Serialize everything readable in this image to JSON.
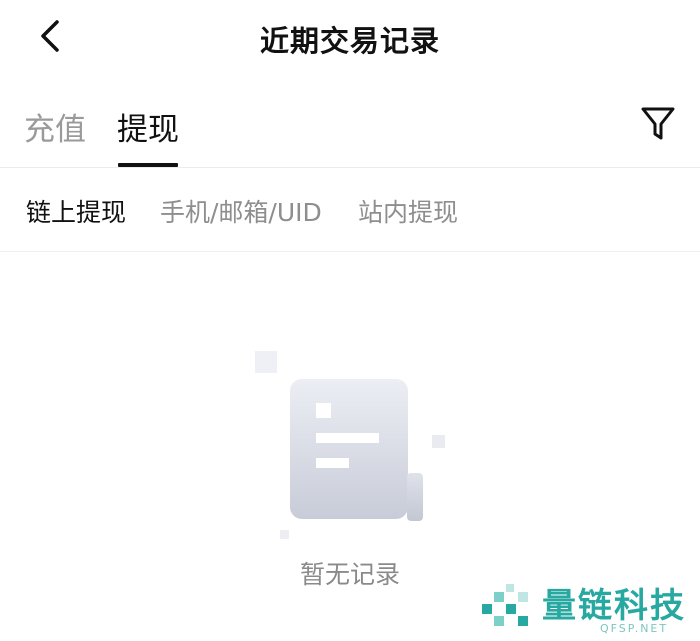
{
  "header": {
    "title": "近期交易记录",
    "back_icon": "chevron-left-icon"
  },
  "tabs": {
    "deposit_label": "充值",
    "withdraw_label": "提现",
    "active": "提现",
    "filter_icon": "filter-funnel-icon"
  },
  "subtabs": {
    "onchain_label": "链上提现",
    "phone_label": "手机/邮箱/UID",
    "internal_label": "站内提现",
    "active": "链上提现"
  },
  "empty_state": {
    "icon": "empty-document-icon",
    "text": "暂无记录"
  },
  "watermark": {
    "text": "量链科技",
    "sub": "QFSP.NET"
  },
  "colors": {
    "accent": "#111111",
    "inactive_text": "#9a9a9a",
    "watermark": "#27a8a0"
  }
}
